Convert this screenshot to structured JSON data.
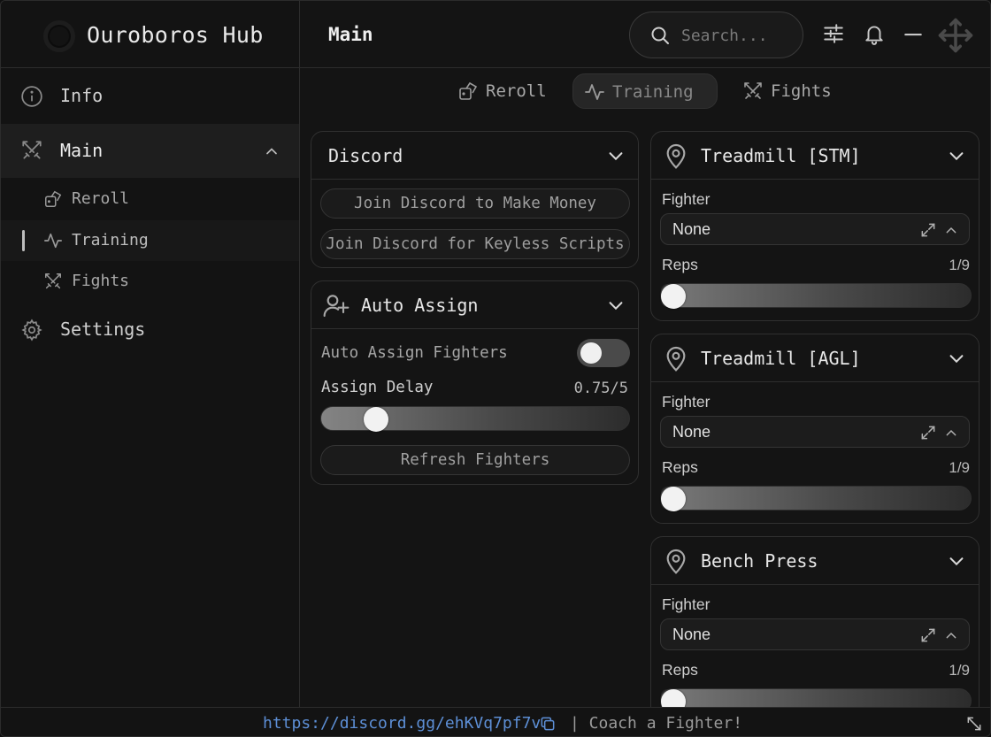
{
  "app": {
    "title": "Ouroboros Hub"
  },
  "sidebar": {
    "items": [
      {
        "label": "Info",
        "icon": "info-icon"
      },
      {
        "label": "Main",
        "icon": "crossed-swords-icon",
        "expanded": true
      },
      {
        "label": "Settings",
        "icon": "gear-icon"
      }
    ],
    "subitems": [
      {
        "label": "Reroll",
        "icon": "dice-icon"
      },
      {
        "label": "Training",
        "icon": "activity-icon",
        "selected": true
      },
      {
        "label": "Fights",
        "icon": "crossed-swords-icon"
      }
    ]
  },
  "header": {
    "title": "Main",
    "search_placeholder": "Search..."
  },
  "tabs": [
    {
      "label": "Reroll",
      "icon": "dice-icon"
    },
    {
      "label": "Training",
      "icon": "activity-icon",
      "active": true
    },
    {
      "label": "Fights",
      "icon": "crossed-swords-icon"
    }
  ],
  "discord_card": {
    "title": "Discord",
    "buttons": [
      "Join Discord to Make Money",
      "Join Discord for Keyless Scripts"
    ]
  },
  "auto_assign_card": {
    "title": "Auto Assign",
    "toggle_label": "Auto Assign Fighters",
    "toggle_on": false,
    "delay_label": "Assign Delay",
    "delay_value_text": "0.75/5",
    "delay_value": 0.75,
    "delay_max": 5,
    "refresh_label": "Refresh Fighters"
  },
  "training_cards": [
    {
      "title": "Treadmill [STM]",
      "fighter_label": "Fighter",
      "fighter_value": "None",
      "reps_label": "Reps",
      "reps_value_text": "1/9",
      "reps_value": 1,
      "reps_max": 9
    },
    {
      "title": "Treadmill [AGL]",
      "fighter_label": "Fighter",
      "fighter_value": "None",
      "reps_label": "Reps",
      "reps_value_text": "1/9",
      "reps_value": 1,
      "reps_max": 9
    },
    {
      "title": "Bench Press",
      "fighter_label": "Fighter",
      "fighter_value": "None",
      "reps_label": "Reps",
      "reps_value_text": "1/9",
      "reps_value": 1,
      "reps_max": 9
    }
  ],
  "footer": {
    "link": "https://discord.gg/ehKVq7pf7v",
    "tagline": "| Coach a Fighter!",
    "link_color": "#5d8fd6"
  }
}
